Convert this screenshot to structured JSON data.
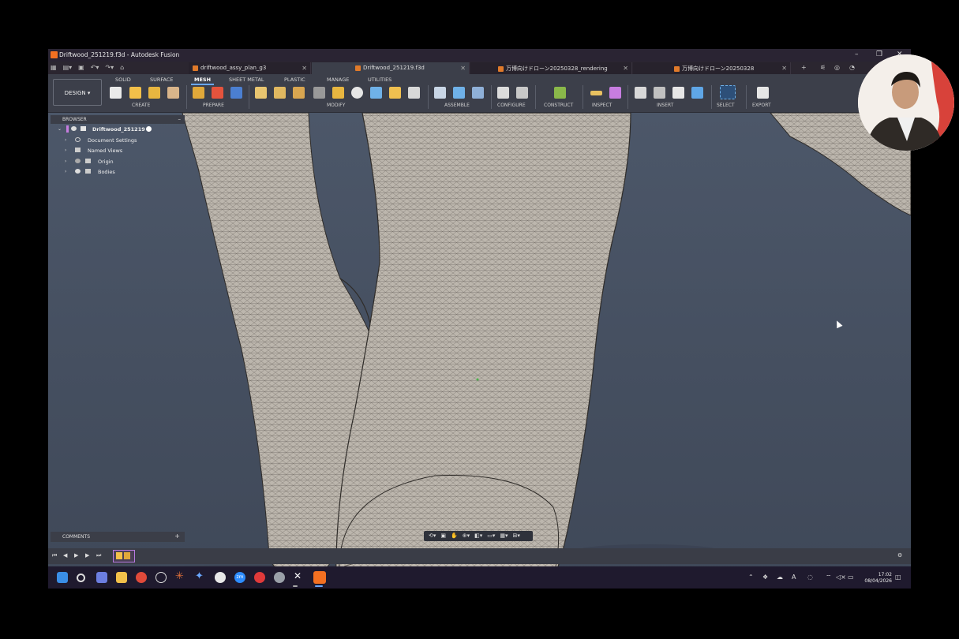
{
  "window": {
    "title": "Driftwood_251219.f3d - Autodesk Fusion",
    "controls": [
      "–",
      "❐",
      "✕"
    ]
  },
  "tabs": [
    {
      "label": "driftwood_assy_plan_g3",
      "active": false
    },
    {
      "label": "Driftwood_251219.f3d",
      "active": true
    },
    {
      "label": "万博向けドローン20250328_rendering",
      "active": false
    },
    {
      "label": "万博向けドローン20250328",
      "active": false
    }
  ],
  "toolbar": {
    "design_label": "DESIGN",
    "workspace_tabs": [
      "SOLID",
      "SURFACE",
      "MESH",
      "SHEET METAL",
      "PLASTIC",
      "MANAGE",
      "UTILITIES"
    ],
    "active_tab": "MESH",
    "groups": [
      "CREATE",
      "PREPARE",
      "MODIFY",
      "ASSEMBLE",
      "CONFIGURE",
      "CONSTRUCT",
      "INSPECT",
      "INSERT",
      "SELECT",
      "EXPORT"
    ]
  },
  "browser": {
    "header": "BROWSER",
    "root": "Driftwood_251219",
    "items": [
      "Document Settings",
      "Named Views",
      "Origin",
      "Bodies"
    ]
  },
  "comments": {
    "header": "COMMENTS"
  },
  "taskbar": {
    "time": "17:02",
    "date": "08/04/2026",
    "zoom_label": "zm"
  },
  "colors": {
    "viewport": "#4a5567",
    "mesh": "#bdb7ae",
    "accent": "#f37021"
  }
}
